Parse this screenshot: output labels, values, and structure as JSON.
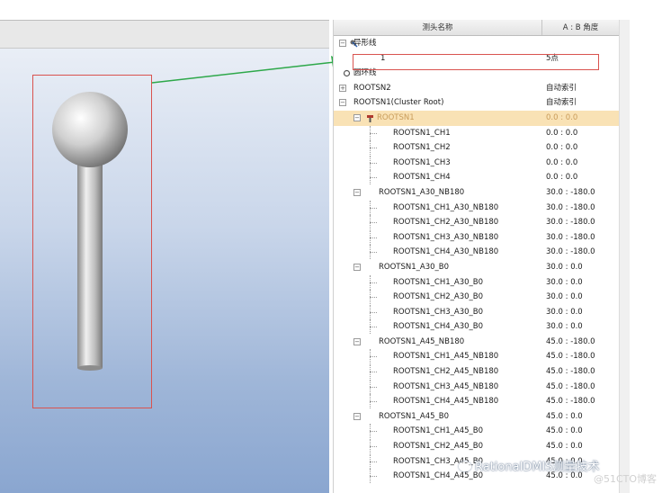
{
  "tree": {
    "header": {
      "name_col": "测头名称",
      "angle_col": "A : B 角度"
    },
    "rows": [
      {
        "name": "异形线",
        "angle": ""
      },
      {
        "name": "1",
        "angle": "5点"
      },
      {
        "name": "圆环线",
        "angle": ""
      },
      {
        "name": "ROOTSN2",
        "angle": "自动索引"
      },
      {
        "name": "ROOTSN1(Cluster Root)",
        "angle": "自动索引"
      },
      {
        "name": "ROOTSN1",
        "angle": "0.0 : 0.0"
      },
      {
        "name": "ROOTSN1_CH1",
        "angle": "0.0 : 0.0"
      },
      {
        "name": "ROOTSN1_CH2",
        "angle": "0.0 : 0.0"
      },
      {
        "name": "ROOTSN1_CH3",
        "angle": "0.0 : 0.0"
      },
      {
        "name": "ROOTSN1_CH4",
        "angle": "0.0 : 0.0"
      },
      {
        "name": "ROOTSN1_A30_NB180",
        "angle": "30.0 : -180.0"
      },
      {
        "name": "ROOTSN1_CH1_A30_NB180",
        "angle": "30.0 : -180.0"
      },
      {
        "name": "ROOTSN1_CH2_A30_NB180",
        "angle": "30.0 : -180.0"
      },
      {
        "name": "ROOTSN1_CH3_A30_NB180",
        "angle": "30.0 : -180.0"
      },
      {
        "name": "ROOTSN1_CH4_A30_NB180",
        "angle": "30.0 : -180.0"
      },
      {
        "name": "ROOTSN1_A30_B0",
        "angle": "30.0 : 0.0"
      },
      {
        "name": "ROOTSN1_CH1_A30_B0",
        "angle": "30.0 : 0.0"
      },
      {
        "name": "ROOTSN1_CH2_A30_B0",
        "angle": "30.0 : 0.0"
      },
      {
        "name": "ROOTSN1_CH3_A30_B0",
        "angle": "30.0 : 0.0"
      },
      {
        "name": "ROOTSN1_CH4_A30_B0",
        "angle": "30.0 : 0.0"
      },
      {
        "name": "ROOTSN1_A45_NB180",
        "angle": "45.0 : -180.0"
      },
      {
        "name": "ROOTSN1_CH1_A45_NB180",
        "angle": "45.0 : -180.0"
      },
      {
        "name": "ROOTSN1_CH2_A45_NB180",
        "angle": "45.0 : -180.0"
      },
      {
        "name": "ROOTSN1_CH3_A45_NB180",
        "angle": "45.0 : -180.0"
      },
      {
        "name": "ROOTSN1_CH4_A45_NB180",
        "angle": "45.0 : -180.0"
      },
      {
        "name": "ROOTSN1_A45_B0",
        "angle": "45.0 : 0.0"
      },
      {
        "name": "ROOTSN1_CH1_A45_B0",
        "angle": "45.0 : 0.0"
      },
      {
        "name": "ROOTSN1_CH2_A45_B0",
        "angle": "45.0 : 0.0"
      },
      {
        "name": "ROOTSN1_CH3_A45_B0",
        "angle": "45.0 : 0.0"
      },
      {
        "name": "ROOTSN1_CH4_A45_B0",
        "angle": "45.0 : 0.0"
      }
    ]
  },
  "watermark": {
    "text": "RationalDMIS测量技术",
    "sub": "@51CTO博客"
  },
  "colors": {
    "selected_row": "#f9e2b5",
    "highlight_box": "#d9534f",
    "arrow": "#2ea84a"
  }
}
